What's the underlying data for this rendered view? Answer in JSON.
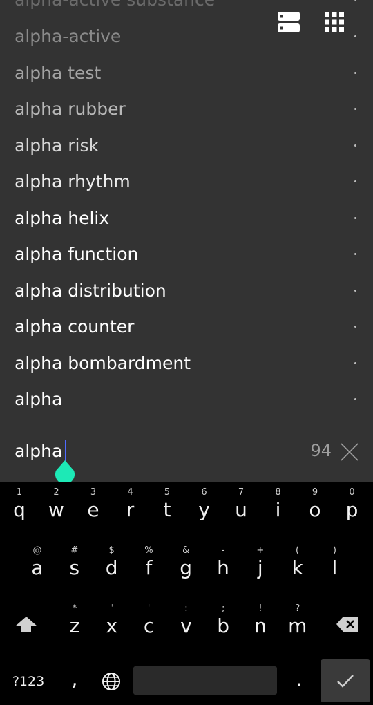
{
  "suggestions": [
    {
      "label": "alpha-active substance",
      "color": "#6b6b6b"
    },
    {
      "label": "alpha-active",
      "color": "#8a8a8a"
    },
    {
      "label": "alpha test",
      "color": "#a3a3a3"
    },
    {
      "label": "alpha rubber",
      "color": "#b8b8b8"
    },
    {
      "label": "alpha risk",
      "color": "#d6d6d6"
    },
    {
      "label": "alpha rhythm",
      "color": "#ececec"
    },
    {
      "label": "alpha helix",
      "color": "#ffffff"
    },
    {
      "label": "alpha function",
      "color": "#ffffff"
    },
    {
      "label": "alpha distribution",
      "color": "#ffffff"
    },
    {
      "label": "alpha counter",
      "color": "#ffffff"
    },
    {
      "label": "alpha bombardment",
      "color": "#ffffff"
    },
    {
      "label": "alpha",
      "color": "#ffffff"
    }
  ],
  "top_icons": [
    "list-view-icon",
    "grid-view-icon"
  ],
  "search": {
    "value": "alpha",
    "count": "94"
  },
  "colors": {
    "background": "#333333",
    "caret": "#4f6bff",
    "handle": "#1de9b6",
    "keyboard": "#000000"
  },
  "keyboard": {
    "row1": [
      {
        "main": "q",
        "hint": "1"
      },
      {
        "main": "w",
        "hint": "2"
      },
      {
        "main": "e",
        "hint": "3"
      },
      {
        "main": "r",
        "hint": "4"
      },
      {
        "main": "t",
        "hint": "5"
      },
      {
        "main": "y",
        "hint": "6"
      },
      {
        "main": "u",
        "hint": "7"
      },
      {
        "main": "i",
        "hint": "8"
      },
      {
        "main": "o",
        "hint": "9"
      },
      {
        "main": "p",
        "hint": "0"
      }
    ],
    "row2": [
      {
        "main": "a",
        "hint": "@"
      },
      {
        "main": "s",
        "hint": "#"
      },
      {
        "main": "d",
        "hint": "$"
      },
      {
        "main": "f",
        "hint": "%"
      },
      {
        "main": "g",
        "hint": "&"
      },
      {
        "main": "h",
        "hint": "-"
      },
      {
        "main": "j",
        "hint": "+"
      },
      {
        "main": "k",
        "hint": "("
      },
      {
        "main": "l",
        "hint": ")"
      }
    ],
    "row3": [
      {
        "main": "z",
        "hint": "*"
      },
      {
        "main": "x",
        "hint": "\""
      },
      {
        "main": "c",
        "hint": "'"
      },
      {
        "main": "v",
        "hint": ":"
      },
      {
        "main": "b",
        "hint": ";"
      },
      {
        "main": "n",
        "hint": "!"
      },
      {
        "main": "m",
        "hint": "?"
      }
    ],
    "symbols_label": "?123",
    "comma": ",",
    "period": "."
  }
}
